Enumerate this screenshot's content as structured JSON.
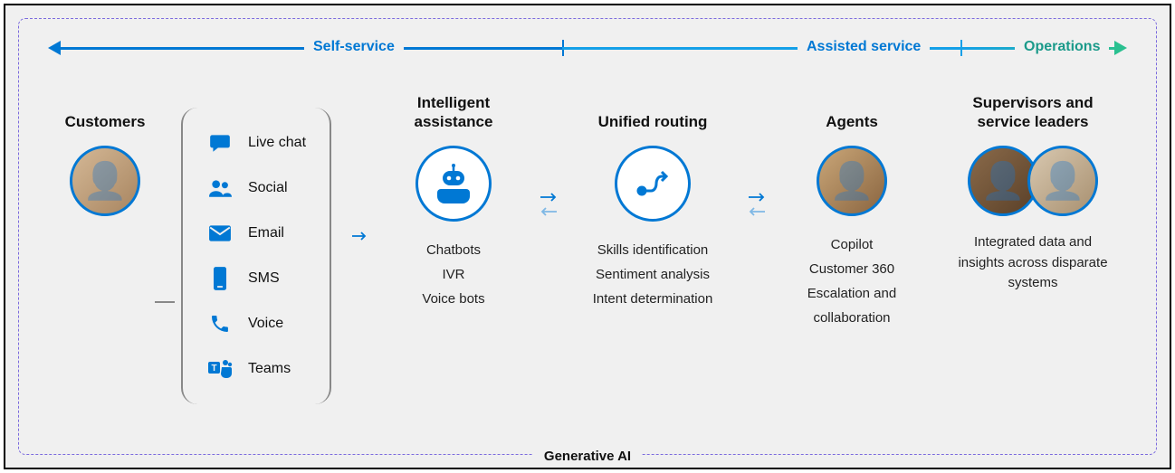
{
  "bar": {
    "self_service": "Self-service",
    "assisted_service": "Assisted service",
    "operations": "Operations"
  },
  "columns": {
    "customers": {
      "title": "Customers"
    },
    "channels": {
      "items": [
        {
          "icon": "chat-icon",
          "label": "Live chat"
        },
        {
          "icon": "social-icon",
          "label": "Social"
        },
        {
          "icon": "email-icon",
          "label": "Email"
        },
        {
          "icon": "sms-icon",
          "label": "SMS"
        },
        {
          "icon": "voice-icon",
          "label": "Voice"
        },
        {
          "icon": "teams-icon",
          "label": "Teams"
        }
      ]
    },
    "intelligent": {
      "title": "Intelligent assistance",
      "sub": [
        "Chatbots",
        "IVR",
        "Voice bots"
      ]
    },
    "routing": {
      "title": "Unified routing",
      "sub": [
        "Skills identification",
        "Sentiment analysis",
        "Intent determination"
      ]
    },
    "agents": {
      "title": "Agents",
      "sub": [
        "Copilot",
        "Customer 360",
        "Escalation and collaboration"
      ]
    },
    "supervisors": {
      "title": "Supervisors and service leaders",
      "sub_text": "Integrated data and insights across disparate systems"
    }
  },
  "footer": "Generative AI"
}
